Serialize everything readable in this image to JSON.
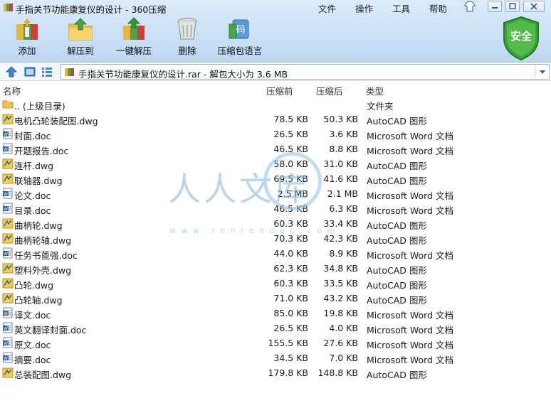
{
  "window": {
    "title": "手指关节功能康复仪的设计 - 360压缩",
    "menu": [
      "文件",
      "操作",
      "工具",
      "帮助"
    ]
  },
  "toolbar": {
    "add": "添加",
    "extract": "解压到",
    "onekey": "一键解压",
    "delete": "删除",
    "lang": "压缩包语言",
    "lang_icon_text": "码"
  },
  "security_badge": "安全",
  "address": {
    "path": "手指关节功能康复仪的设计.rar - 解包大小为 3.6 MB"
  },
  "columns": {
    "name": "名称",
    "packed": "压缩前",
    "unpacked": "压缩后",
    "type": "类型"
  },
  "files": [
    {
      "name": ".. (上级目录)",
      "packed": "",
      "unpacked": "",
      "type": "文件夹",
      "icon": "folder-icon"
    },
    {
      "name": "电机凸轮装配图.dwg",
      "packed": "78.5 KB",
      "unpacked": "50.3 KB",
      "type": "AutoCAD 图形",
      "icon": "dwg-file-icon"
    },
    {
      "name": "封面.doc",
      "packed": "26.5 KB",
      "unpacked": "3.6 KB",
      "type": "Microsoft Word 文档",
      "icon": "doc-file-icon"
    },
    {
      "name": "开题报告.doc",
      "packed": "46.5 KB",
      "unpacked": "8.8 KB",
      "type": "Microsoft Word 文档",
      "icon": "doc-file-icon"
    },
    {
      "name": "连杆.dwg",
      "packed": "58.0 KB",
      "unpacked": "31.0 KB",
      "type": "AutoCAD 图形",
      "icon": "dwg-file-icon"
    },
    {
      "name": "联轴器.dwg",
      "packed": "69.5 KB",
      "unpacked": "41.6 KB",
      "type": "AutoCAD 图形",
      "icon": "dwg-file-icon"
    },
    {
      "name": "论文.doc",
      "packed": "2.5 MB",
      "unpacked": "2.1 MB",
      "type": "Microsoft Word 文档",
      "icon": "doc-file-icon"
    },
    {
      "name": "目录.doc",
      "packed": "46.5 KB",
      "unpacked": "6.3 KB",
      "type": "Microsoft Word 文档",
      "icon": "doc-file-icon"
    },
    {
      "name": "曲柄轮.dwg",
      "packed": "60.3 KB",
      "unpacked": "33.4 KB",
      "type": "AutoCAD 图形",
      "icon": "dwg-file-icon"
    },
    {
      "name": "曲柄轮轴.dwg",
      "packed": "70.3 KB",
      "unpacked": "42.3 KB",
      "type": "AutoCAD 图形",
      "icon": "dwg-file-icon"
    },
    {
      "name": "任务书蓖强.doc",
      "packed": "44.0 KB",
      "unpacked": "8.9 KB",
      "type": "Microsoft Word 文档",
      "icon": "doc-file-icon"
    },
    {
      "name": "塑料外壳.dwg",
      "packed": "62.3 KB",
      "unpacked": "34.8 KB",
      "type": "AutoCAD 图形",
      "icon": "dwg-file-icon"
    },
    {
      "name": "凸轮.dwg",
      "packed": "60.3 KB",
      "unpacked": "33.5 KB",
      "type": "AutoCAD 图形",
      "icon": "dwg-file-icon"
    },
    {
      "name": "凸轮轴.dwg",
      "packed": "71.0 KB",
      "unpacked": "43.2 KB",
      "type": "AutoCAD 图形",
      "icon": "dwg-file-icon"
    },
    {
      "name": "译文.doc",
      "packed": "85.0 KB",
      "unpacked": "19.8 KB",
      "type": "Microsoft Word 文档",
      "icon": "doc-file-icon"
    },
    {
      "name": "英文翻译封面.doc",
      "packed": "26.5 KB",
      "unpacked": "4.0 KB",
      "type": "Microsoft Word 文档",
      "icon": "doc-file-icon"
    },
    {
      "name": "原文.doc",
      "packed": "155.5 KB",
      "unpacked": "27.6 KB",
      "type": "Microsoft Word 文档",
      "icon": "doc-file-icon"
    },
    {
      "name": "摘要.doc",
      "packed": "34.5 KB",
      "unpacked": "7.0 KB",
      "type": "Microsoft Word 文档",
      "icon": "doc-file-icon"
    },
    {
      "name": "总装配图.dwg",
      "packed": "179.8 KB",
      "unpacked": "148.8 KB",
      "type": "AutoCAD 图形",
      "icon": "dwg-file-icon"
    }
  ],
  "watermark": {
    "text": "人人文库",
    "url": "www.renrendoc.com"
  },
  "colors": {
    "header_top": "#dcebfa",
    "header_bottom": "#bcd6f0",
    "shield_green": "#3aa33a",
    "watermark_blue": "#7fb4dc"
  }
}
